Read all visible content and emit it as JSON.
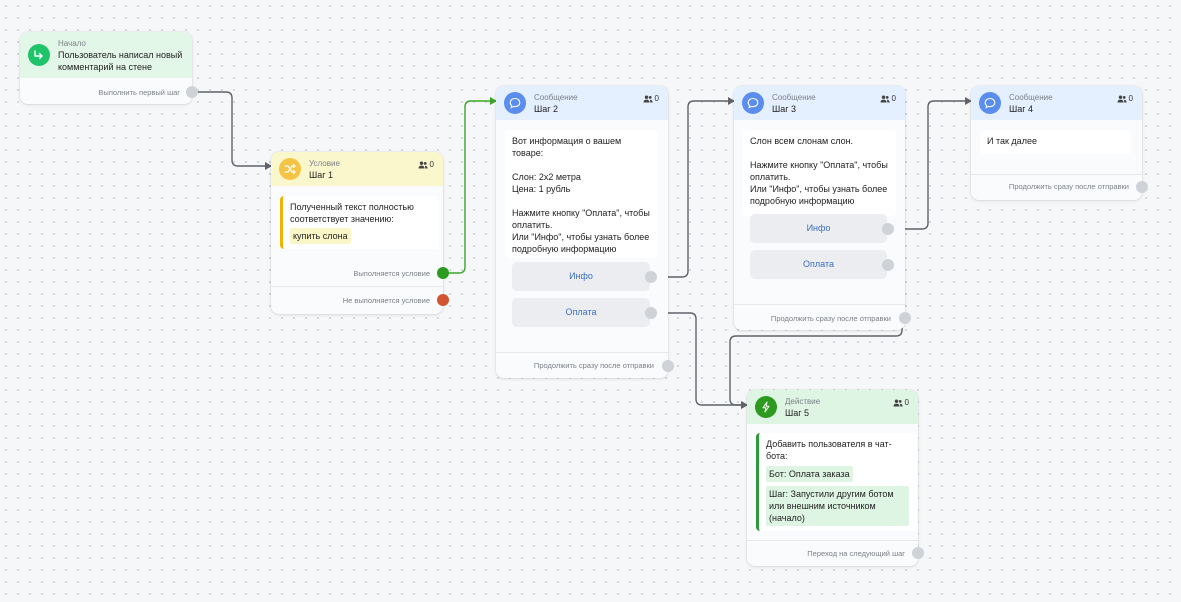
{
  "nodes": {
    "start": {
      "kind": "Начало",
      "title": "Пользователь написал новый комментарий на стене",
      "footer": "Выполнить первый шаг"
    },
    "step1": {
      "kind": "Условие",
      "title": "Шаг 1",
      "count": "0",
      "text": "Полученный текст полностью соответствует значению:",
      "value": "купить слона",
      "out_true": "Выполняется условие",
      "out_false": "Не выполняется условие"
    },
    "step2": {
      "kind": "Сообщение",
      "title": "Шаг 2",
      "count": "0",
      "text": "Вот информация о вашем товаре:\n\nСлон: 2x2 метра\nЦена: 1 рубль\n\nНажмите кнопку \"Оплата\", чтобы оплатить.\nИли \"Инфо\", чтобы узнать более подробную информацию",
      "buttons": [
        "Инфо",
        "Оплата"
      ],
      "footer": "Продолжить сразу после отправки"
    },
    "step3": {
      "kind": "Сообщение",
      "title": "Шаг 3",
      "count": "0",
      "text": "Слон всем слонам слон.\n\nНажмите кнопку \"Оплата\", чтобы оплатить.\nИли \"Инфо\", чтобы узнать более подробную информацию",
      "buttons": [
        "Инфо",
        "Оплата"
      ],
      "footer": "Продолжить сразу после отправки"
    },
    "step4": {
      "kind": "Сообщение",
      "title": "Шаг 4",
      "count": "0",
      "text": "И так далее",
      "footer": "Продолжить сразу после отправки"
    },
    "step5": {
      "kind": "Действие",
      "title": "Шаг 5",
      "count": "0",
      "text": "Добавить пользователя в чат-бота:",
      "tag1": "Бот: Оплата заказа",
      "tag2": "Шаг: Запустили другим ботом или внешним источником (начало)",
      "footer": "Переход на следующий шаг"
    }
  },
  "colors": {
    "start_icon": "#1fc36a",
    "condition_icon": "#f6c445",
    "message_icon": "#5b8def",
    "action_icon": "#2c9a1e",
    "port_true": "#2c9a1e",
    "port_false": "#d25532",
    "wire": "#5f6368",
    "wire_active": "#3aa628"
  },
  "icons": {
    "start": "arrow-enter-icon",
    "condition": "shuffle-icon",
    "message": "chat-bubble-icon",
    "action": "lightning-icon",
    "count": "users-icon"
  }
}
